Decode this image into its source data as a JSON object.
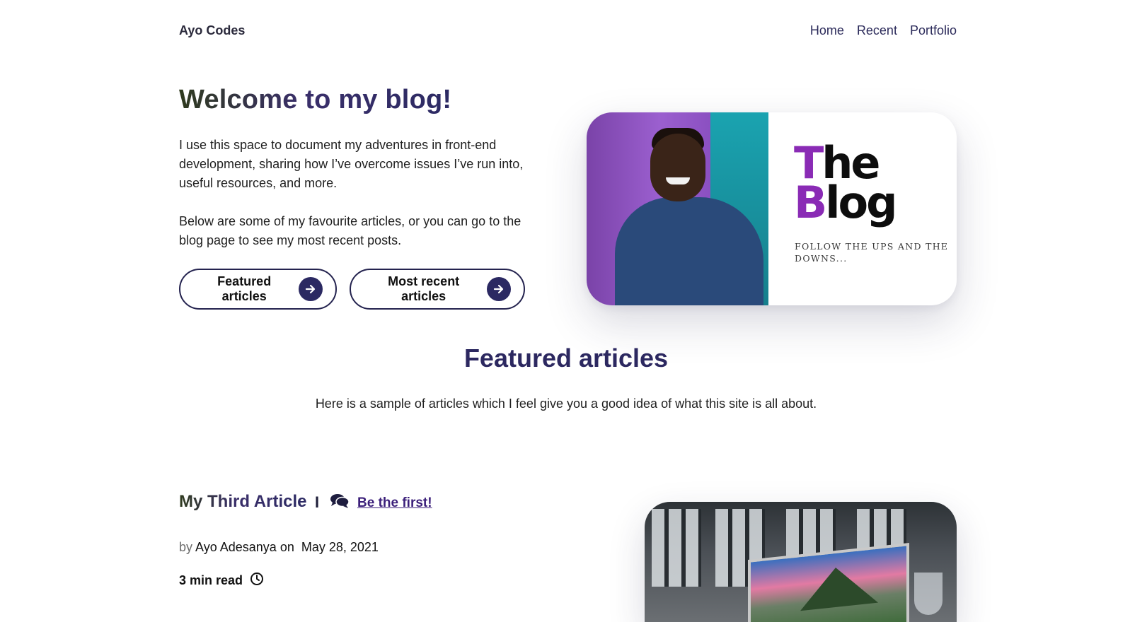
{
  "header": {
    "brand": "Ayo Codes",
    "nav": [
      "Home",
      "Recent",
      "Portfolio"
    ]
  },
  "hero": {
    "title": "Welcome to my blog!",
    "paragraph1": "I use this space to document my adventures in front-end development, sharing how I’ve overcome issues I’ve run into, useful resources, and more.",
    "paragraph2": "Below are some of my favourite articles, or you can go to the blog page to see my most recent posts.",
    "buttons": [
      "Featured articles",
      "Most recent articles"
    ],
    "card": {
      "logo_line1_first": "T",
      "logo_line1_rest": "he",
      "logo_line2_first": "B",
      "logo_line2_rest": "log",
      "tagline": "FOLLOW THE UPS AND THE DOWNS..."
    }
  },
  "featured": {
    "title": "Featured articles",
    "subtitle": "Here is a sample of articles which I feel give you a good idea of what this site is all about."
  },
  "article": {
    "title": "My Third Article",
    "separator": "I",
    "comments_link": "Be the first!",
    "by_label": "by",
    "author": "Ayo Adesanya",
    "on_label": "on",
    "date": "May 28, 2021",
    "read_time": "3 min read"
  },
  "colors": {
    "accent_dark": "#2b2962",
    "logo_purple": "#8a2bb5",
    "link_purple": "#3b1f7a"
  }
}
